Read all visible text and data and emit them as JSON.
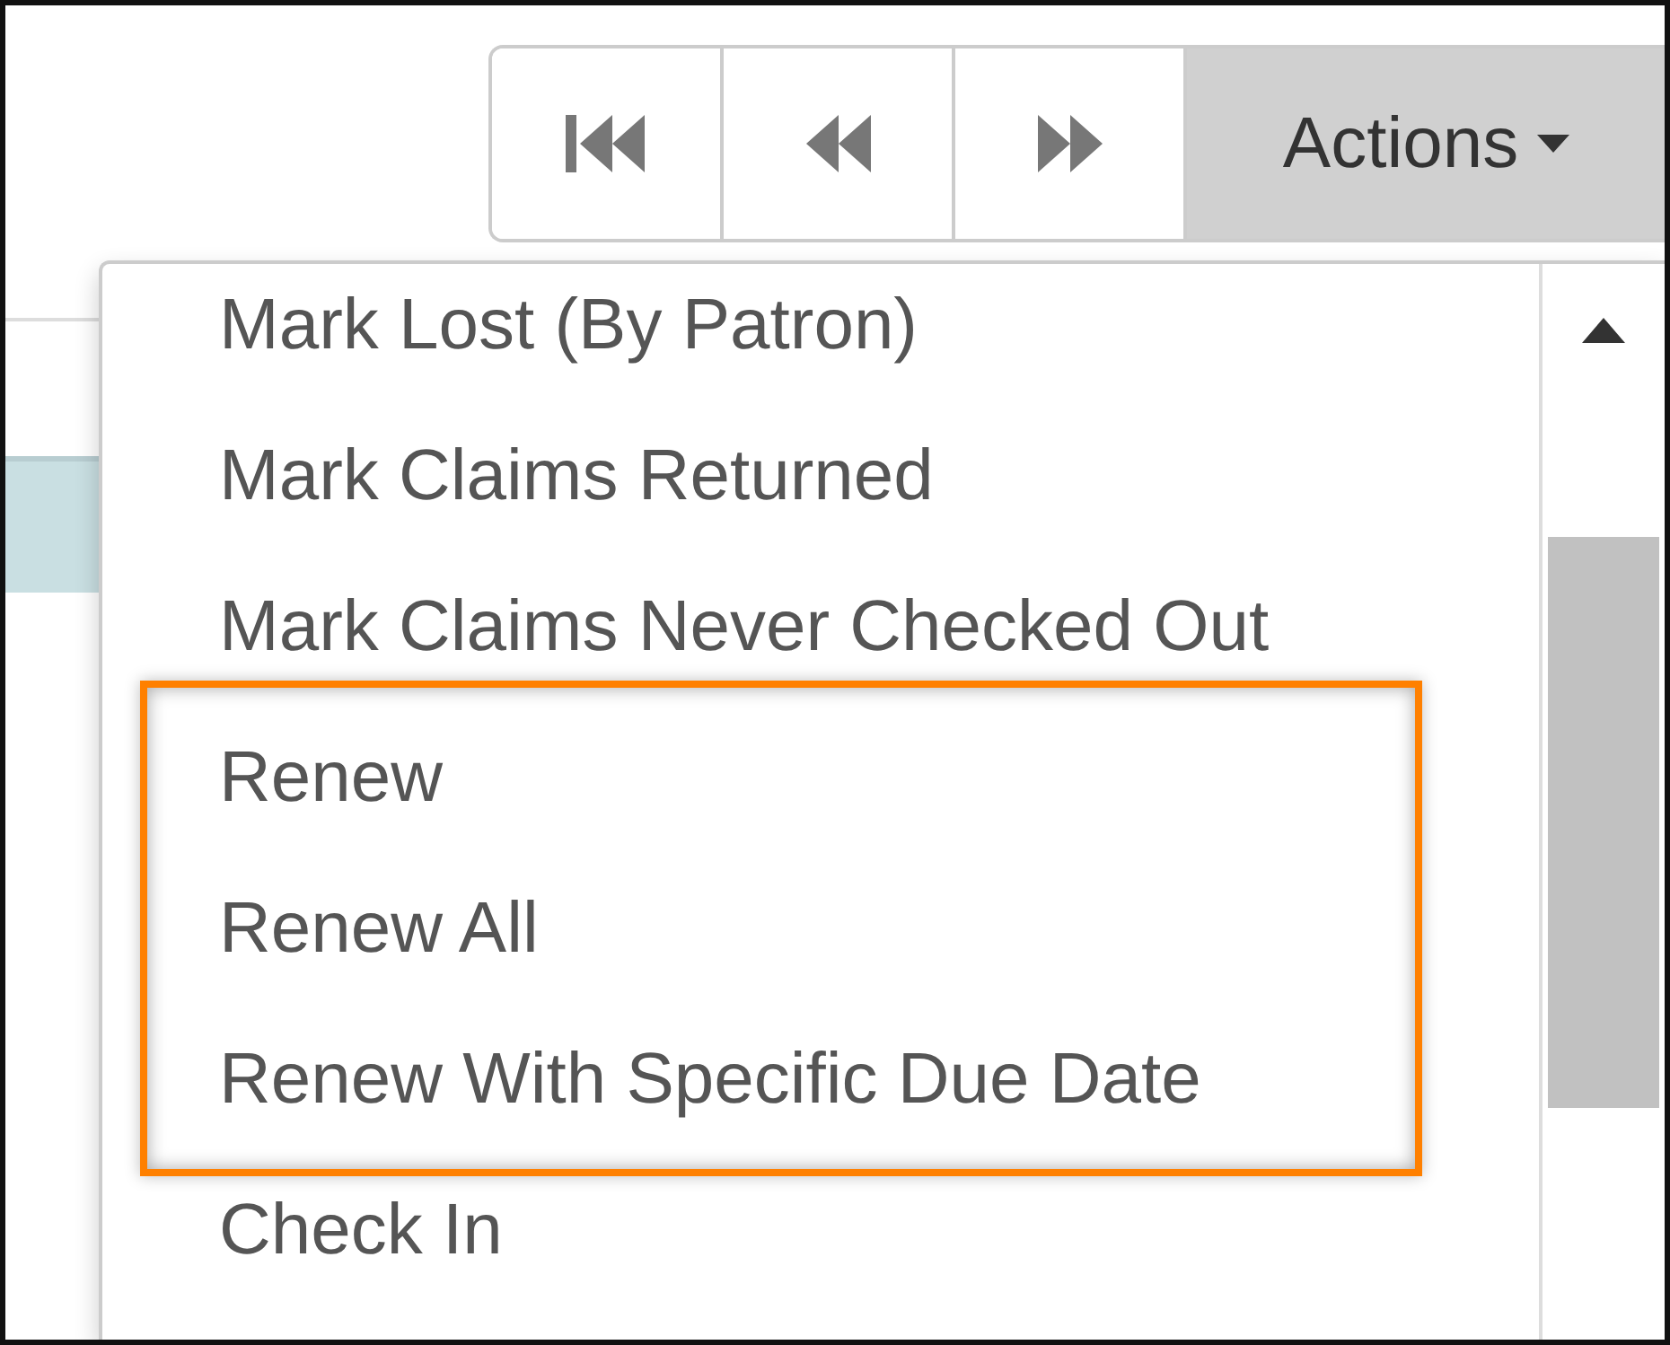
{
  "toolbar": {
    "nav_buttons": [
      {
        "kind": "first"
      },
      {
        "kind": "previous"
      },
      {
        "kind": "next"
      }
    ],
    "actions_button": {
      "label": "Actions"
    }
  },
  "menu": {
    "items": [
      {
        "label": "Mark Lost (By Patron)",
        "highlighted": false
      },
      {
        "label": "Mark Claims Returned",
        "highlighted": false
      },
      {
        "label": "Mark Claims Never Checked Out",
        "highlighted": false
      },
      {
        "label": "Renew",
        "highlighted": true
      },
      {
        "label": "Renew All",
        "highlighted": true
      },
      {
        "label": "Renew With Specific Due Date",
        "highlighted": true
      },
      {
        "label": "Check In",
        "highlighted": false
      }
    ]
  }
}
